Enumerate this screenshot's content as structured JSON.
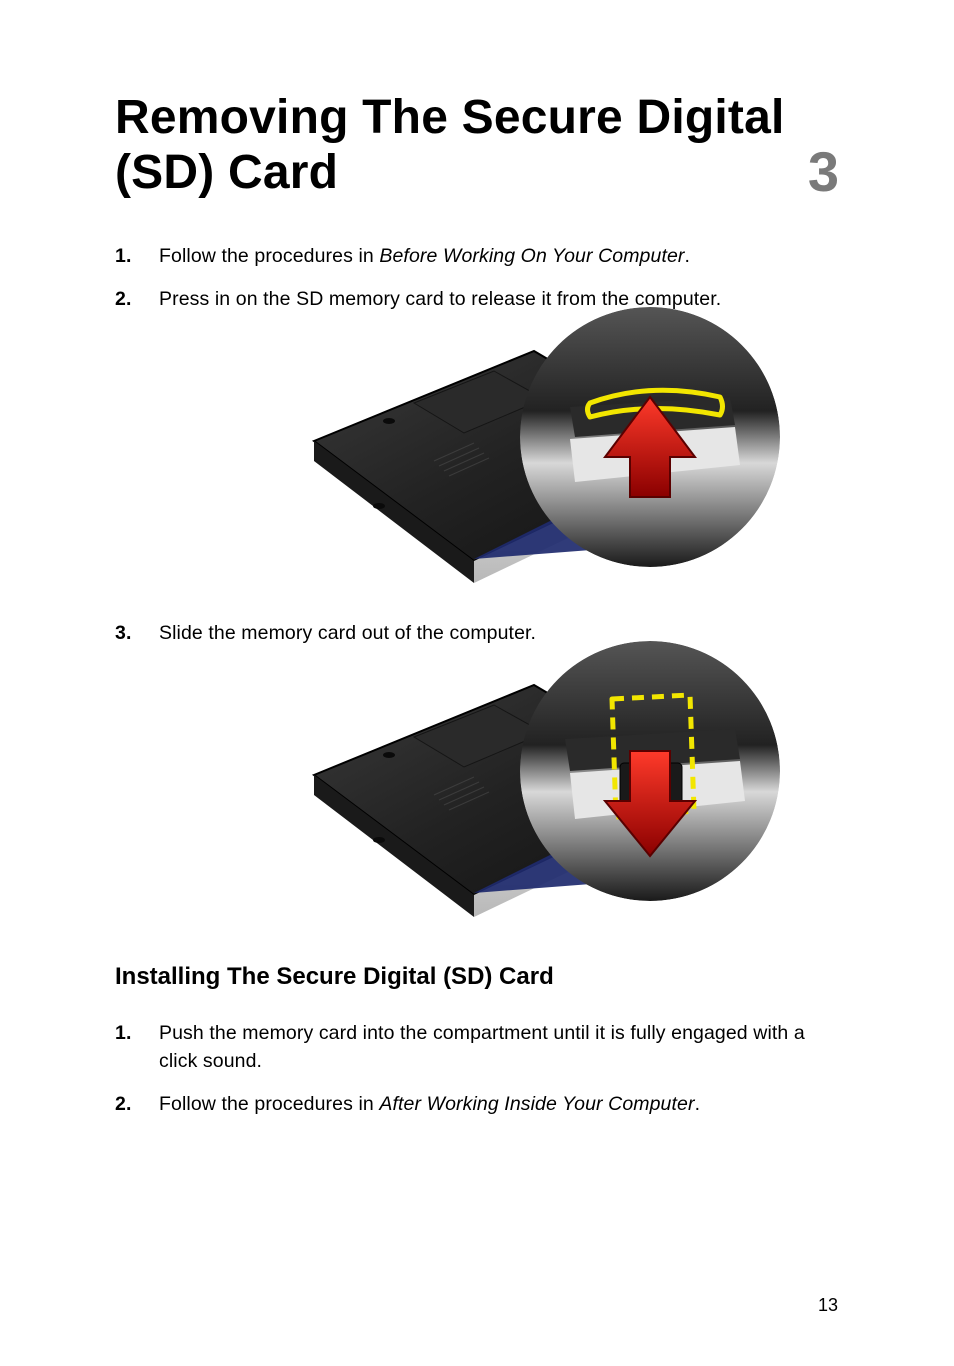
{
  "header": {
    "title": "Removing The Secure Digital (SD) Card",
    "chapter_number": "3"
  },
  "removing_steps": [
    {
      "prefix": "Follow the procedures in ",
      "italic": "Before Working On Your Computer",
      "suffix": "."
    },
    {
      "text": "Press in on the SD memory card to release it from the computer."
    },
    {
      "text": "Slide the memory card out of the computer."
    }
  ],
  "install_section": {
    "heading": "Installing The Secure Digital (SD) Card"
  },
  "install_steps": [
    {
      "text": "Push the memory card into the compartment until it is fully engaged with a click sound."
    },
    {
      "prefix": "Follow the procedures in ",
      "italic": "After Working Inside Your Computer",
      "suffix": "."
    }
  ],
  "page_number": "13"
}
